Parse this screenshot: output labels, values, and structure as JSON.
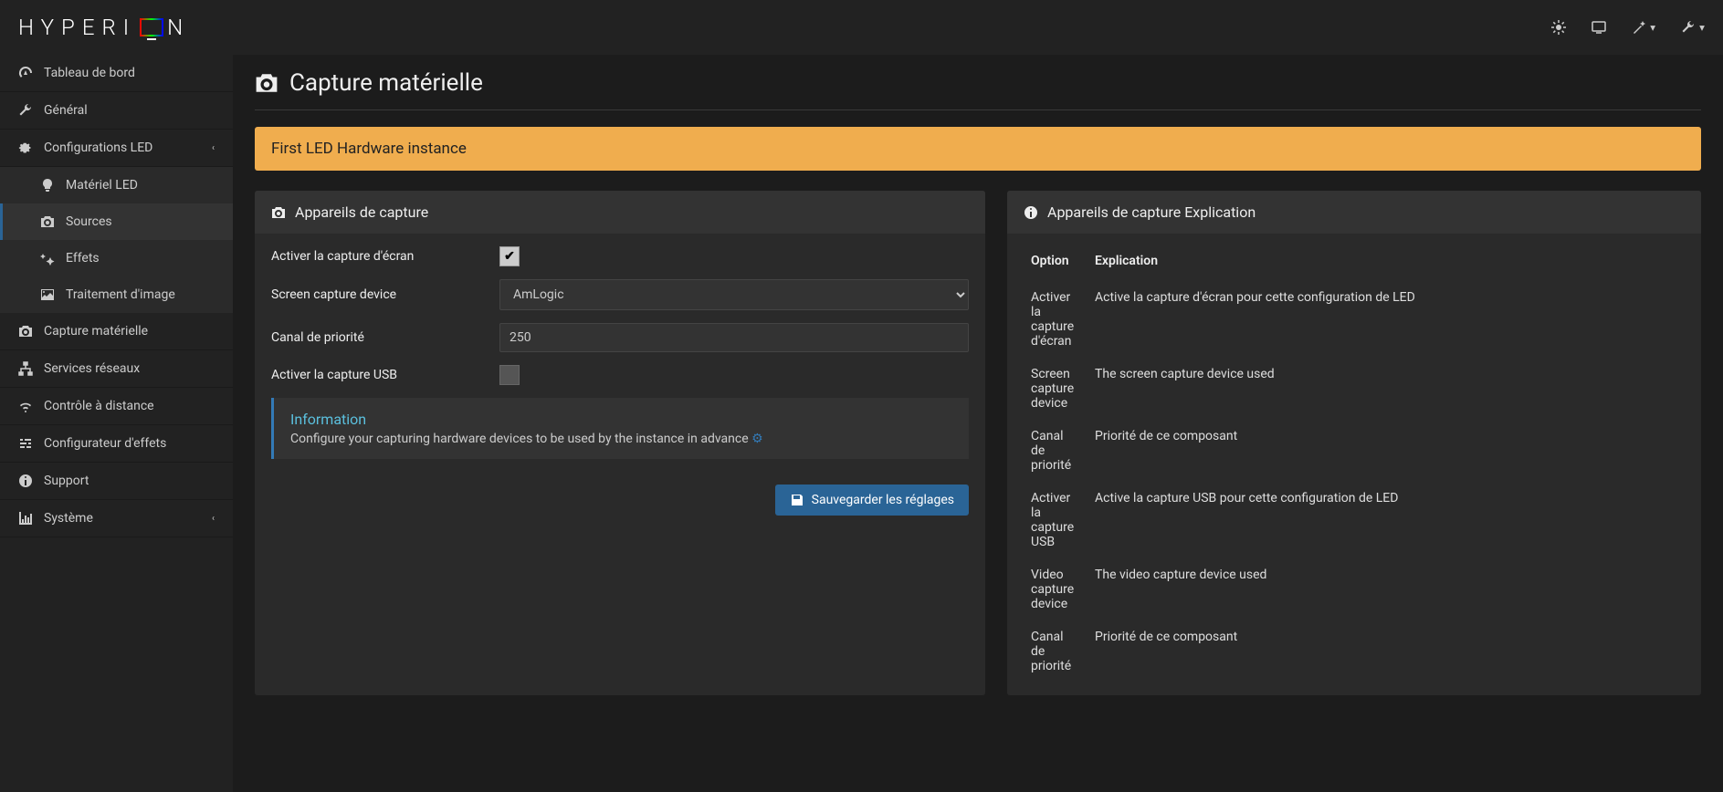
{
  "logo": "HYPERION",
  "sidebar": {
    "items": [
      {
        "label": "Tableau de bord",
        "icon": "dashboard"
      },
      {
        "label": "Général",
        "icon": "wrench"
      },
      {
        "label": "Configurations LED",
        "icon": "gear",
        "expandable": true
      },
      {
        "label": "Matériel LED",
        "icon": "lightbulb",
        "sub": true
      },
      {
        "label": "Sources",
        "icon": "camera",
        "sub": true,
        "active": true
      },
      {
        "label": "Effets",
        "icon": "sparkle",
        "sub": true
      },
      {
        "label": "Traitement d'image",
        "icon": "picture",
        "sub": true
      },
      {
        "label": "Capture matérielle",
        "icon": "camera"
      },
      {
        "label": "Services réseaux",
        "icon": "sitemap"
      },
      {
        "label": "Contrôle à distance",
        "icon": "wifi"
      },
      {
        "label": "Configurateur d'effets",
        "icon": "sliders"
      },
      {
        "label": "Support",
        "icon": "info"
      },
      {
        "label": "Système",
        "icon": "chart",
        "expandable": true
      }
    ]
  },
  "page": {
    "title": "Capture matérielle",
    "alert": "First LED Hardware instance"
  },
  "capture_panel": {
    "title": "Appareils de capture",
    "fields": {
      "enable_screen_label": "Activer la capture d'écran",
      "enable_screen_checked": true,
      "device_label": "Screen capture device",
      "device_value": "AmLogic",
      "priority_label": "Canal de priorité",
      "priority_value": "250",
      "enable_usb_label": "Activer la capture USB",
      "enable_usb_checked": false
    },
    "info_title": "Information",
    "info_text": "Configure your capturing hardware devices to be used by the instance in advance",
    "save_button": "Sauvegarder les réglages"
  },
  "explain_panel": {
    "title": "Appareils de capture Explication",
    "headers": {
      "option": "Option",
      "explication": "Explication"
    },
    "rows": [
      {
        "option": "Activer la capture d'écran",
        "text": "Active la capture d'écran pour cette configuration de LED"
      },
      {
        "option": "Screen capture device",
        "text": "The screen capture device used"
      },
      {
        "option": "Canal de priorité",
        "text": "Priorité de ce composant"
      },
      {
        "option": "Activer la capture USB",
        "text": "Active la capture USB pour cette configuration de LED"
      },
      {
        "option": "Video capture device",
        "text": "The video capture device used"
      },
      {
        "option": "Canal de priorité",
        "text": "Priorité de ce composant"
      }
    ]
  }
}
